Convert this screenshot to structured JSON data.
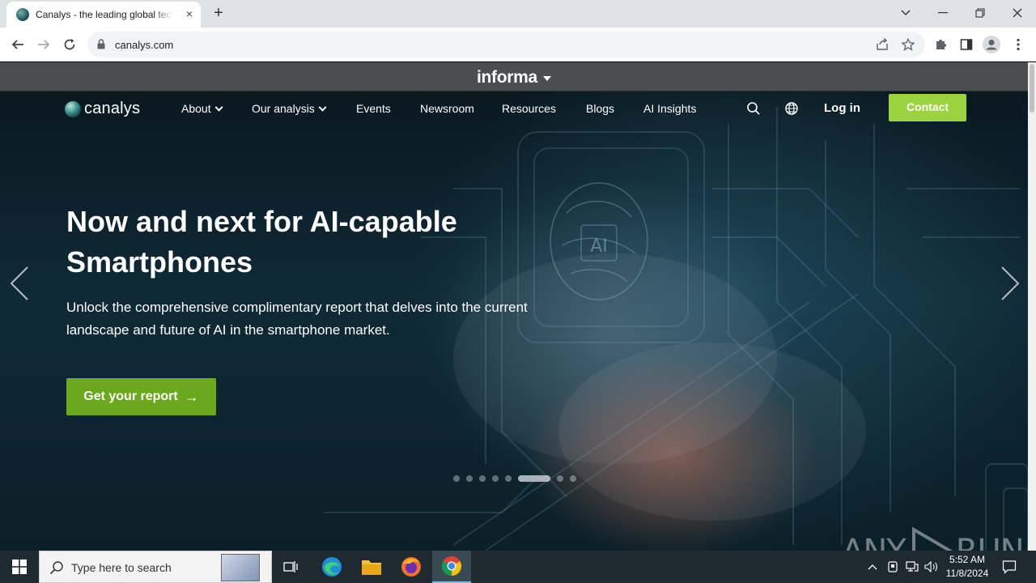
{
  "browser": {
    "tab_title": "Canalys - the leading global technology market analyst firm",
    "tab_close": "×",
    "new_tab": "+",
    "url": "canalys.com"
  },
  "informa": {
    "label": "informa"
  },
  "site_nav": {
    "logo": "canalys",
    "items": [
      {
        "label": "About",
        "dropdown": true
      },
      {
        "label": "Our analysis",
        "dropdown": true
      },
      {
        "label": "Events"
      },
      {
        "label": "Newsroom"
      },
      {
        "label": "Resources"
      },
      {
        "label": "Blogs"
      },
      {
        "label": "AI Insights"
      }
    ],
    "login": "Log in",
    "contact": "Contact"
  },
  "hero": {
    "headline_line1": "Now and next for AI-capable",
    "headline_line2": "Smartphones",
    "subtext_line1": "Unlock the comprehensive complimentary report that delves into the current",
    "subtext_line2": "landscape and future of AI in the smartphone market.",
    "cta": "Get your report",
    "cta_arrow": "→",
    "carousel_total": 8,
    "carousel_active": 6
  },
  "watermark": {
    "left": "ANY",
    "right": "RUN"
  },
  "taskbar": {
    "search_placeholder": "Type here to search",
    "time": "5:52 AM",
    "date": "11/8/2024"
  },
  "colors": {
    "accent_green": "#9bd33f",
    "cta_green": "#6aa81e",
    "informa_bar": "#4a4e50",
    "taskbar": "#1f2a30"
  }
}
